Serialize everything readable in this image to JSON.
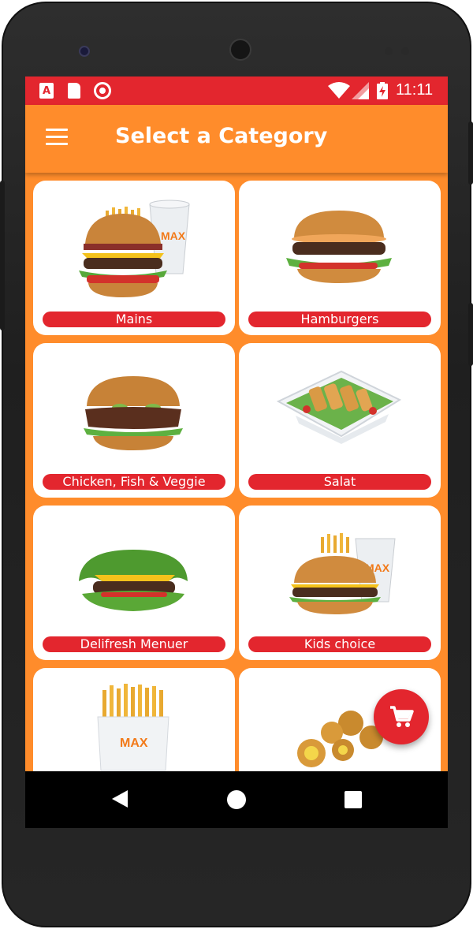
{
  "status_bar": {
    "time": "11:11",
    "notification_icon_letter": "A"
  },
  "app_bar": {
    "title": "Select a Category",
    "menu_icon": "hamburger-menu-icon"
  },
  "categories": [
    {
      "label": "Mains",
      "image": "burger-meal-with-drink"
    },
    {
      "label": "Hamburgers",
      "image": "hamburger"
    },
    {
      "label": "Chicken, Fish & Veggie",
      "image": "crispy-chicken-burger"
    },
    {
      "label": "Salat",
      "image": "chicken-salad-bowl"
    },
    {
      "label": "Delifresh Menuer",
      "image": "lettuce-wrapped-burger"
    },
    {
      "label": "Kids choice",
      "image": "kids-meal"
    },
    {
      "label": "",
      "image": "fries-carton"
    },
    {
      "label": "",
      "image": "cheese-bites"
    }
  ],
  "brand": {
    "logo_text": "MAX"
  },
  "fab": {
    "icon": "shopping-cart-icon"
  },
  "nav": {
    "back": "back-icon",
    "home": "home-icon",
    "recent": "recent-apps-icon"
  },
  "colors": {
    "primary": "#ff8c2b",
    "accent": "#e3262e",
    "card": "#ffffff"
  }
}
